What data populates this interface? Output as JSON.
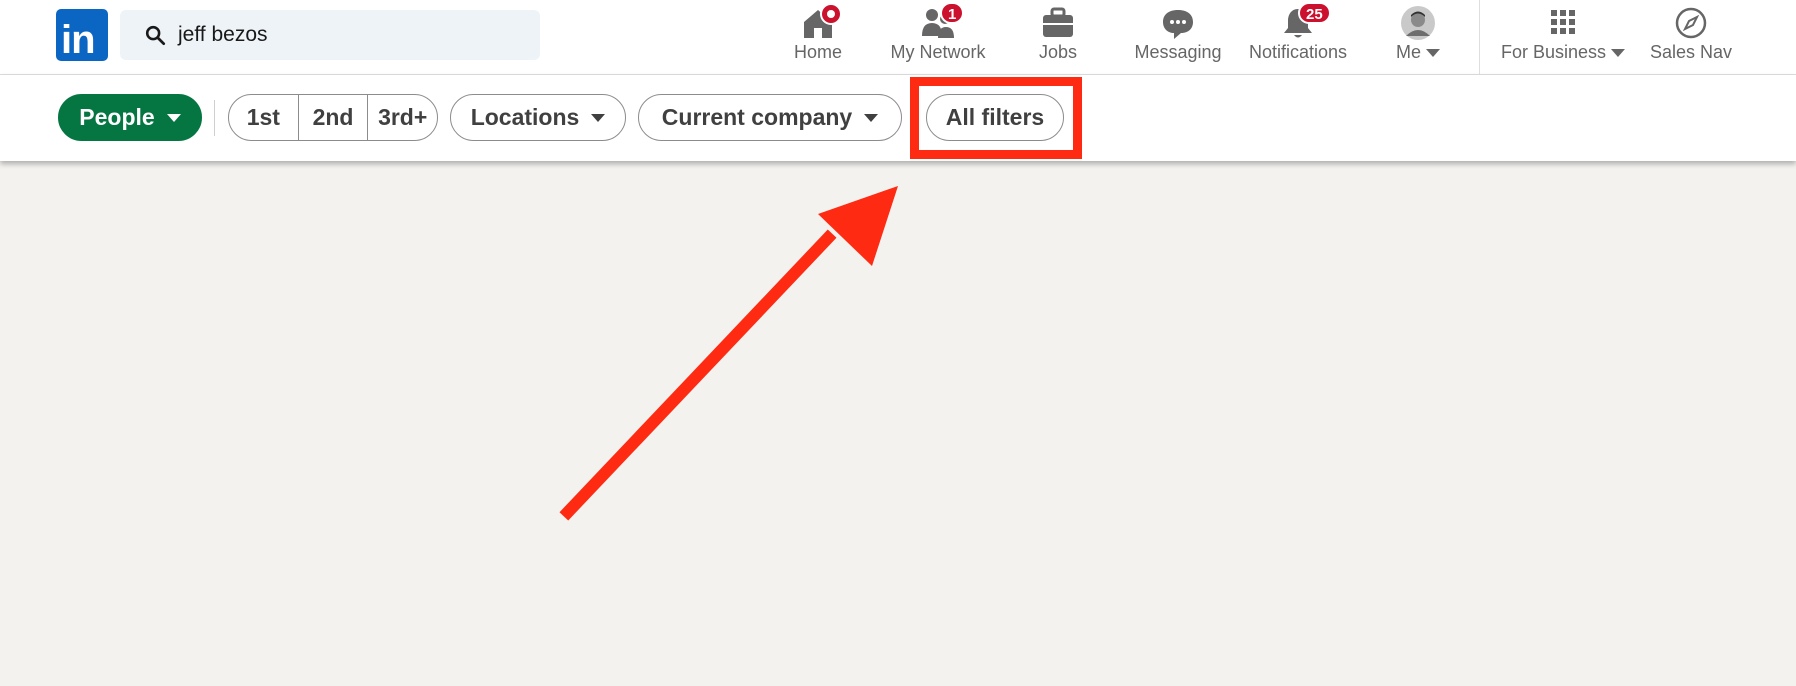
{
  "brand": {
    "logo_text": "in",
    "brand_color": "#0a66c2"
  },
  "search": {
    "value": "jeff bezos",
    "icon": "search-icon"
  },
  "nav": {
    "home": {
      "label": "Home",
      "icon": "house-icon",
      "has_dot_badge": true
    },
    "network": {
      "label": "My Network",
      "icon": "people-icon",
      "badge": "1"
    },
    "jobs": {
      "label": "Jobs",
      "icon": "briefcase-icon"
    },
    "messaging": {
      "label": "Messaging",
      "icon": "chat-bubble-icon"
    },
    "notifications": {
      "label": "Notifications",
      "icon": "bell-icon",
      "badge": "25"
    },
    "me": {
      "label": "Me",
      "icon": "avatar"
    },
    "business": {
      "label": "For Business",
      "icon": "grid-icon"
    },
    "salesnav": {
      "label": "Sales Nav",
      "icon": "compass-icon"
    }
  },
  "filters": {
    "people": "People",
    "degrees": [
      "1st",
      "2nd",
      "3rd+"
    ],
    "locations": "Locations",
    "current_company": "Current company",
    "all_filters": "All filters"
  },
  "colors": {
    "active_filter": "#057642",
    "badge": "#cb112d",
    "annotation": "#ff2a12",
    "page_bg": "#f3f2ef"
  }
}
